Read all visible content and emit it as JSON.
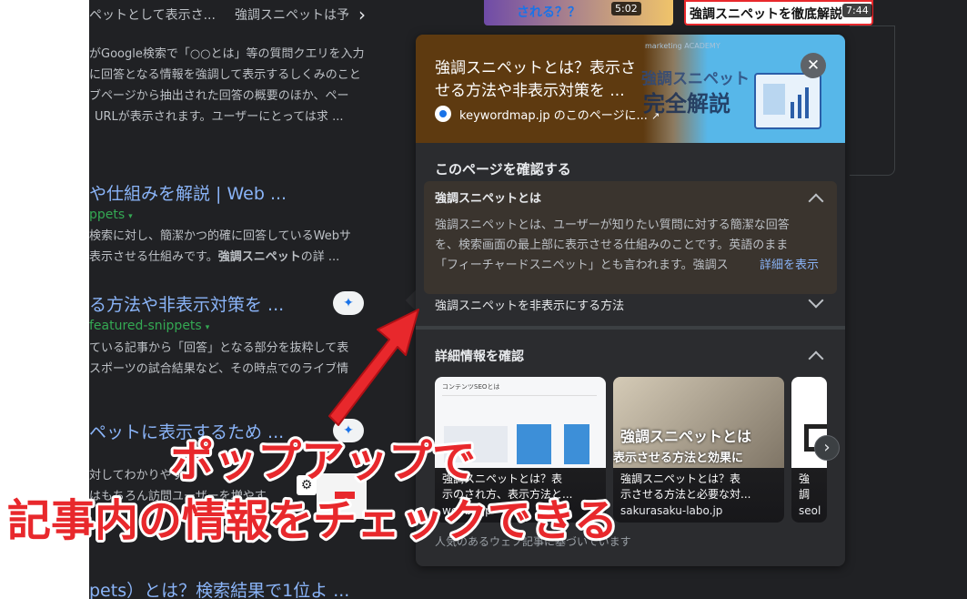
{
  "left_results": {
    "top_line_1": "ペットとして表示さ...",
    "top_line_2": "強調スニペットは予",
    "snippet_1": [
      "がGoogle検索で「○○とは」等の質問クエリを入力",
      "に回答となる情報を強調して表示するしくみのこと",
      "ブページから抽出された回答の概要のほか、ペー",
      "URLが表示されます。ユーザーにとっては求 ..."
    ],
    "result_2_title": "や仕組みを解説 | Web ...",
    "result_2_url": "ppets",
    "result_2_snippet": [
      "検索に対し、簡潔かつ的確に回答しているWebサ",
      "表示させる仕組みです。",
      "強調スニペット",
      "の詳 ..."
    ],
    "result_3_title": "る方法や非表示対策を ...",
    "result_3_url": "featured-snippets",
    "result_3_snippet": [
      "ている記事から「回答」となる部分を抜粋して表",
      "スポーツの試合結果など、その時点でのライブ情"
    ],
    "result_4_title": "ペットに表示するため ...",
    "result_4_snippet": [
      "対してわかりやす",
      "はもちろん訪問ユーザーを増やす"
    ],
    "result_5_title": "pets）とは？検索結果で1位よ ..."
  },
  "top_thumbs": {
    "badge_1": "される？？",
    "duration_1": "5:02",
    "title_2": "強調スニペットを徹底解説",
    "duration_2": "7:44"
  },
  "popup": {
    "title": "強調スニペットとは？表示させる方法や非表示対策を ...",
    "title_line1": "強調スニペットとは？表示さ",
    "title_line2": "せる方法や非表示対策を ...",
    "source": "keywordmap.jp のこのページに...",
    "banner_line1": "強調スニペット",
    "banner_line2": "完全解説",
    "banner_small": "marketing ACADEMY",
    "section_title": "このページを確認する",
    "accordion_1": {
      "title": "強調スニペットとは",
      "body_line1": "強調スニペットとは、ユーザーが知りたい質問に対する簡潔な回答",
      "body_line2": "を、検索画面の最上部に表示させる仕組みのことです。英語のまま",
      "body_line3": "「フィーチャードスニペット」とも言われます。強調ス",
      "more_link": "詳細を表示"
    },
    "accordion_2": {
      "title": "強調スニペットを非表示にする方法"
    },
    "details_title": "詳細情報を確認",
    "cards": [
      {
        "caption": "強調スニペットとは？表示のされ方、表示方法と...",
        "caption_line1": "強調スニペットとは？表",
        "caption_line2": "示のされ方、表示方法と...",
        "source": "webbu.jp",
        "overlay": "コンテンツSEOとは"
      },
      {
        "caption": "強調スニペットとは？表示させる方法と必要な対...",
        "caption_line1": "強調スニペットとは？表",
        "caption_line2": "示させる方法と必要な対...",
        "source": "sakurasaku-labo.jp",
        "overlay_1": "強調スニペットとは",
        "overlay_2": "表示させる方法と効果に"
      },
      {
        "caption": "強調",
        "caption_line1": "強調",
        "caption_line2": "",
        "source": "seol"
      }
    ],
    "footer_note": "人気のあるウェブ記事に基づいています"
  },
  "annotation": {
    "line1": "ポップアップで",
    "line2": "記事内の情報をチェックできる",
    "color": "#e8282c"
  },
  "colors": {
    "page_bg": "#202124",
    "link": "#8ab4f8",
    "url": "#34a853",
    "popup_bg": "#2b2c2f"
  }
}
